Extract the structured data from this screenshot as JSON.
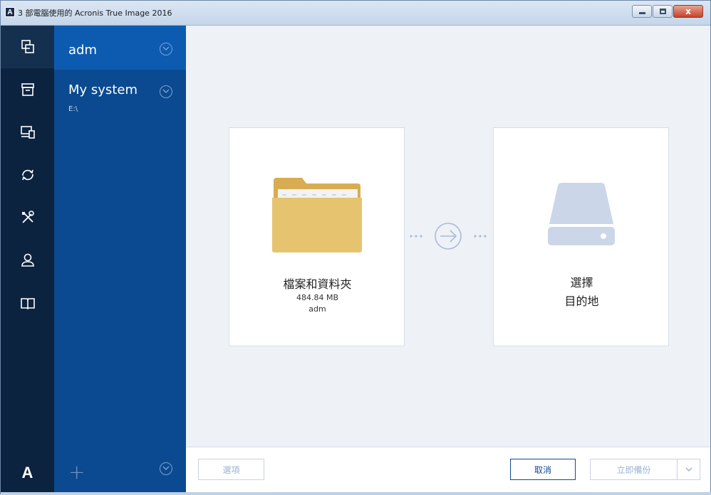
{
  "window": {
    "title": "3 部電腦使用的 Acronis True Image 2016",
    "app_icon_letter": "A",
    "close_glyph": "x"
  },
  "rail": {
    "items": [
      {
        "icon": "backup-icon",
        "active": true
      },
      {
        "icon": "archive-icon",
        "active": false
      },
      {
        "icon": "devices-icon",
        "active": false
      },
      {
        "icon": "sync-icon",
        "active": false
      },
      {
        "icon": "tools-icon",
        "active": false
      },
      {
        "icon": "account-icon",
        "active": false
      },
      {
        "icon": "help-book-icon",
        "active": false
      }
    ],
    "logo": "A"
  },
  "sources": {
    "items": [
      {
        "title": "adm",
        "subtitle": ""
      },
      {
        "title": "My system",
        "subtitle": "E:\\"
      }
    ],
    "add_label": "+"
  },
  "source_card": {
    "title": "檔案和資料夾",
    "size": "484.84 MB",
    "owner": "adm"
  },
  "destination_card": {
    "line1": "選擇",
    "line2": "目的地"
  },
  "bottom": {
    "options_label": "選項",
    "cancel_label": "取消",
    "backup_now_label": "立即備份"
  },
  "colors": {
    "rail": "#0c2340",
    "sources": "#0b4a90",
    "selected": "#0d5bb0",
    "folder": "#e6c46f",
    "drive": "#cbd7e8"
  }
}
